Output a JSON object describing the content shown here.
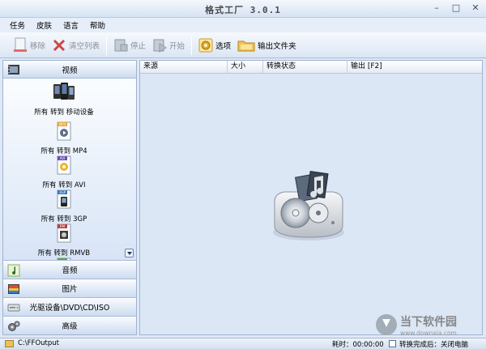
{
  "window": {
    "title": "格式工厂 3.0.1"
  },
  "menu": [
    "任务",
    "皮肤",
    "语言",
    "帮助"
  ],
  "toolbar": {
    "remove": "移除",
    "clear_list": "清空列表",
    "stop": "停止",
    "start": "开始",
    "options": "选项",
    "output_folder": "输出文件夹"
  },
  "sidebar": {
    "video": "视频",
    "video_items": [
      "所有 转到 移动设备",
      "所有 转到 MP4",
      "所有 转到 AVI",
      "所有 转到 3GP",
      "所有 转到 RMVB"
    ],
    "video_badges": [
      "MP4",
      "AVI",
      "3GP",
      "RM"
    ],
    "audio": "音频",
    "image": "图片",
    "disc": "光驱设备\\DVD\\CD\\ISO",
    "advanced": "高级"
  },
  "table": {
    "columns": [
      "来源",
      "大小",
      "转换状态",
      "输出 [F2]"
    ]
  },
  "statusbar": {
    "path": "C:\\FFOutput",
    "elapsed": "耗时：00:00:00",
    "after_convert": "转换完成后：关闭电脑"
  },
  "watermark": {
    "name": "当下软件园",
    "url": "www.downxia.com"
  },
  "colors": {
    "panel_blue": "#dce7f5",
    "accent": "#1f3a66"
  }
}
